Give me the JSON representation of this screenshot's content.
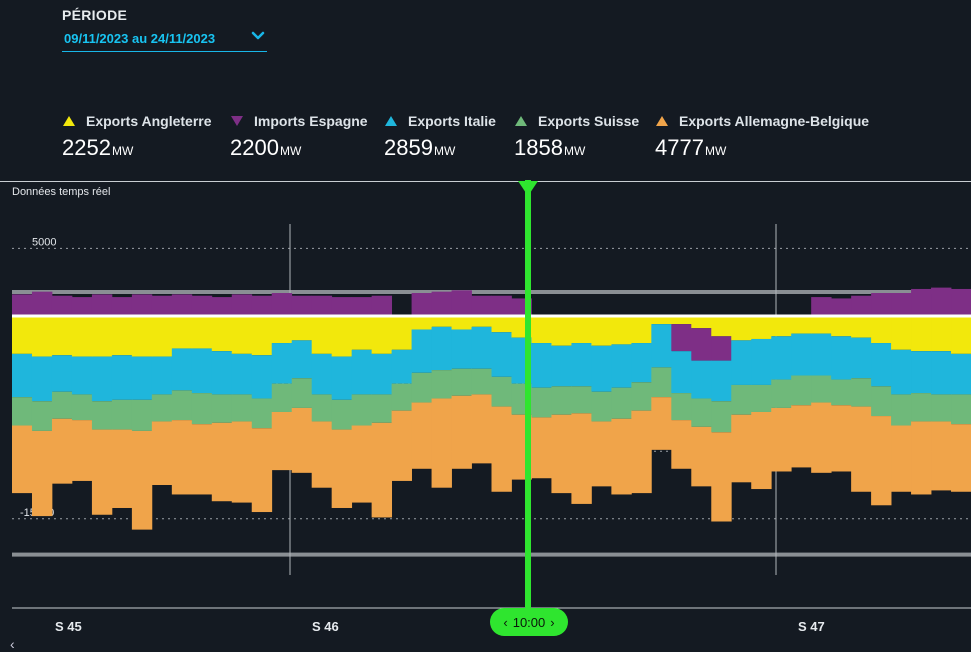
{
  "period": {
    "label": "PÉRIODE",
    "value": "09/11/2023 au 24/11/2023"
  },
  "legend": [
    {
      "name": "Exports Angleterre",
      "value": "2252",
      "unit": "MW",
      "color": "#f2e80c",
      "arrow": "up"
    },
    {
      "name": "Imports Espagne",
      "value": "2200",
      "unit": "MW",
      "color": "#7e2f86",
      "arrow": "down"
    },
    {
      "name": "Exports Italie",
      "value": "2859",
      "unit": "MW",
      "color": "#1fb6dc",
      "arrow": "up"
    },
    {
      "name": "Exports Suisse",
      "value": "1858",
      "unit": "MW",
      "color": "#6fb97a",
      "arrow": "up"
    },
    {
      "name": "Exports Allemagne-Belgique",
      "value": "4777",
      "unit": "MW",
      "color": "#f0a44a",
      "arrow": "up"
    }
  ],
  "realtime_label": "Données temps réel",
  "cursor_time": "10:00",
  "weeks": [
    "S 45",
    "S 46",
    "S 47"
  ],
  "chart_data": {
    "type": "bar",
    "stacked": true,
    "ylim": [
      -18000,
      7500
    ],
    "y_ticks": [
      5000,
      0,
      -5000,
      -10000,
      -15000
    ],
    "grid": true,
    "legend_position": "top",
    "x_ticks": [
      "S 45",
      "S 46",
      "S 47"
    ],
    "cursor": "10:00",
    "series": [
      {
        "name": "Exports Angleterre",
        "color": "#f2e80c",
        "values": [
          -2800,
          -3000,
          -2900,
          -3000,
          -3000,
          -2900,
          -3000,
          -3000,
          -2400,
          -2400,
          -2600,
          -2800,
          -2900,
          -2000,
          -1800,
          -2800,
          -3000,
          -2500,
          -2800,
          -2500,
          -1000,
          -800,
          -1000,
          -800,
          -1200,
          -1600,
          -2000,
          -2200,
          -2000,
          -2200,
          -2100,
          -2000,
          -600,
          -600,
          -900,
          -1500,
          -1800,
          -1700,
          -1500,
          -1300,
          -1300,
          -1500,
          -1600,
          -2000,
          -2500,
          -2600,
          -2600,
          -2800
        ]
      },
      {
        "name": "Imports Espagne",
        "color": "#7e2f86",
        "values": [
          1600,
          1800,
          1500,
          1400,
          1600,
          1400,
          1600,
          1500,
          1600,
          1500,
          1400,
          1600,
          1500,
          1700,
          1500,
          1500,
          1400,
          1400,
          1500,
          0,
          1700,
          1800,
          1900,
          1500,
          1500,
          1300,
          0,
          0,
          0,
          0,
          0,
          0,
          0,
          -2000,
          -2400,
          -1800,
          0,
          0,
          0,
          0,
          1400,
          1300,
          1500,
          1700,
          1700,
          2000,
          2100,
          2000
        ]
      },
      {
        "name": "Exports Italie",
        "color": "#1fb6dc",
        "values": [
          -3200,
          -3300,
          -2700,
          -2800,
          -3300,
          -3300,
          -3200,
          -2800,
          -3100,
          -3300,
          -3200,
          -3000,
          -3200,
          -3000,
          -2800,
          -3000,
          -3200,
          -3300,
          -3000,
          -2500,
          -3200,
          -3200,
          -2900,
          -3100,
          -3300,
          -3400,
          -3300,
          -3000,
          -3200,
          -3400,
          -3200,
          -2900,
          -3200,
          -3100,
          -2800,
          -3000,
          -3300,
          -3400,
          -3200,
          -3100,
          -3100,
          -3200,
          -3000,
          -3200,
          -3300,
          -3100,
          -3200,
          -3000
        ]
      },
      {
        "name": "Exports Suisse",
        "color": "#6fb97a",
        "values": [
          -2100,
          -2200,
          -2000,
          -1900,
          -2100,
          -2200,
          -2300,
          -2000,
          -2200,
          -2300,
          -2100,
          -2000,
          -2200,
          -2100,
          -2200,
          -2000,
          -2200,
          -2300,
          -2100,
          -2000,
          -2200,
          -2100,
          -2000,
          -1900,
          -2200,
          -2300,
          -2200,
          -2100,
          -2000,
          -2200,
          -2300,
          -2100,
          -2200,
          -2000,
          -2100,
          -2300,
          -2200,
          -2000,
          -2100,
          -2200,
          -2000,
          -1900,
          -2100,
          -2200,
          -2300,
          -2100,
          -2000,
          -2200
        ]
      },
      {
        "name": "Exports Allemagne-Belgique",
        "color": "#f0a44a",
        "values": [
          -5000,
          -6300,
          -4800,
          -4500,
          -6300,
          -5800,
          -7300,
          -4700,
          -5500,
          -5200,
          -5800,
          -6000,
          -6200,
          -4300,
          -4800,
          -4900,
          -5800,
          -5700,
          -7000,
          -5200,
          -4900,
          -6600,
          -5400,
          -5100,
          -6300,
          -4800,
          -4500,
          -5800,
          -6700,
          -4800,
          -5600,
          -6100,
          -3900,
          -3600,
          -4400,
          -6600,
          -5000,
          -5700,
          -4700,
          -4600,
          -5200,
          -4900,
          -6300,
          -6600,
          -4900,
          -5400,
          -5100,
          -5000
        ]
      }
    ]
  }
}
